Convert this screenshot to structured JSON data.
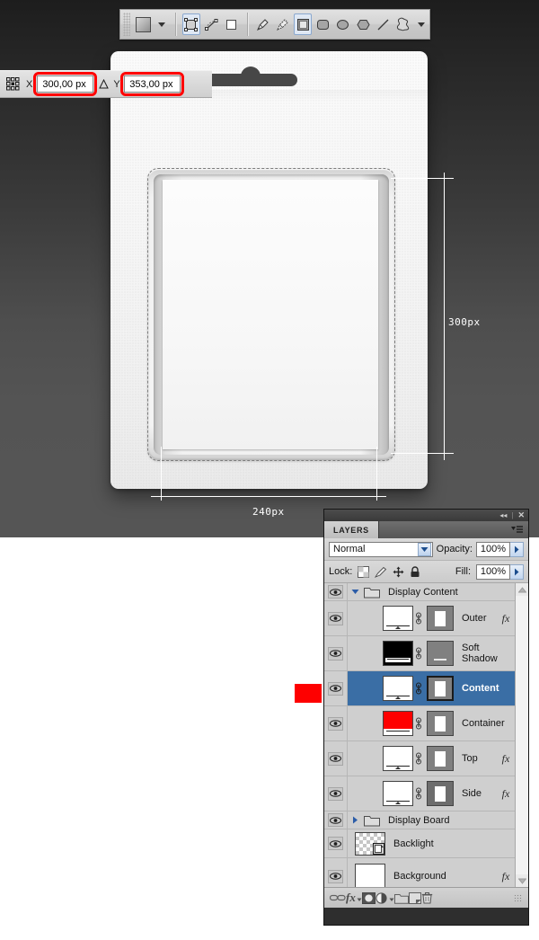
{
  "toolbar": {
    "shape_swatch_icon": "filled-square-swatch",
    "swatch_dropdown_icon": "chevron-down-icon",
    "mode_buttons": [
      {
        "name": "shape-layers-mode",
        "icon": "shape-layer-icon",
        "selected": true
      },
      {
        "name": "paths-mode",
        "icon": "path-icon",
        "selected": false
      },
      {
        "name": "fill-pixels-mode",
        "icon": "fill-pixels-icon",
        "selected": false
      }
    ],
    "tool_buttons": [
      {
        "name": "pen-tool",
        "icon": "pen-icon",
        "selected": false
      },
      {
        "name": "freeform-pen-tool",
        "icon": "freeform-pen-icon",
        "selected": false
      },
      {
        "name": "rectangle-tool",
        "icon": "rectangle-icon",
        "selected": true
      },
      {
        "name": "rounded-rectangle-tool",
        "icon": "rounded-rectangle-icon",
        "selected": false
      },
      {
        "name": "ellipse-tool",
        "icon": "ellipse-icon",
        "selected": false
      },
      {
        "name": "polygon-tool",
        "icon": "polygon-icon",
        "selected": false
      },
      {
        "name": "line-tool",
        "icon": "line-icon",
        "selected": false
      },
      {
        "name": "custom-shape-tool",
        "icon": "custom-shape-icon",
        "selected": false
      }
    ],
    "shapes_dropdown_icon": "chevron-down-icon"
  },
  "coord_bar": {
    "grid_icon": "reference-point-grid-icon",
    "x_label": "X:",
    "x_value": "300,00 px",
    "delta_icon": "delta-triangle-icon",
    "y_label": "Y:",
    "y_value": "353,00 px",
    "highlight_color": "#ff0000"
  },
  "measurements": {
    "height_label": "300px",
    "width_label": "240px",
    "guide_color": "#ffffff"
  },
  "swatch": {
    "name": "red-color-swatch",
    "color": "#fe0000"
  },
  "layers_panel": {
    "collapse_icon": "collapse-to-icons-icon",
    "close_icon": "close-icon",
    "tab_label": "LAYERS",
    "menu_icon": "panel-menu-icon",
    "blend_mode": "Normal",
    "blend_dropdown_icon": "chevron-down-icon",
    "opacity_label": "Opacity:",
    "opacity_value": "100%",
    "opacity_arrow_icon": "chevron-right-icon",
    "lock_label": "Lock:",
    "lock_icons": [
      {
        "name": "lock-transparent-pixels-icon",
        "glyph": "checker"
      },
      {
        "name": "lock-image-pixels-icon",
        "glyph": "brush"
      },
      {
        "name": "lock-position-icon",
        "glyph": "move"
      },
      {
        "name": "lock-all-icon",
        "glyph": "padlock"
      }
    ],
    "fill_label": "Fill:",
    "fill_value": "100%",
    "fill_arrow_icon": "chevron-right-icon",
    "selection_color": "#3a6ea5",
    "scroll_up_icon": "scroll-up-arrow-icon",
    "scroll_down_icon": "scroll-down-arrow-icon",
    "layers": [
      {
        "name": "Display Content",
        "kind": "group",
        "expanded": true,
        "visible": true,
        "disclosure_icon": "triangle-down-icon",
        "folder_icon": "folder-icon"
      },
      {
        "name": "Outer",
        "kind": "layer",
        "visible": true,
        "thumb": "doc-white",
        "mask": "white-rect",
        "link_icon": "link-chain-icon",
        "fx": true,
        "fx_label": "fx",
        "fx_arrow_icon": "triangle-down-icon",
        "selected": false
      },
      {
        "name": "Soft Shadow",
        "kind": "layer",
        "visible": true,
        "thumb": "doc-black",
        "mask": "line",
        "link_icon": "link-chain-icon",
        "fx": false,
        "selected": false
      },
      {
        "name": "Content",
        "kind": "layer",
        "visible": true,
        "thumb": "doc-white",
        "mask": "white-rect",
        "link_icon": "link-chain-icon",
        "fx": false,
        "selected": true
      },
      {
        "name": "Container",
        "kind": "layer",
        "visible": true,
        "thumb": "doc-red",
        "mask": "white-rect",
        "link_icon": "link-chain-icon",
        "fx": false,
        "selected": false
      },
      {
        "name": "Top",
        "kind": "layer",
        "visible": true,
        "thumb": "doc-white",
        "mask": "white-rect",
        "link_icon": "link-chain-icon",
        "fx": true,
        "fx_label": "fx",
        "fx_arrow_icon": "triangle-down-icon",
        "selected": false
      },
      {
        "name": "Side",
        "kind": "layer",
        "visible": true,
        "thumb": "doc-white",
        "mask": "white-rect",
        "link_icon": "link-chain-icon",
        "fx": true,
        "fx_label": "fx",
        "fx_arrow_icon": "triangle-down-icon",
        "selected": false
      },
      {
        "name": "Display Board",
        "kind": "group",
        "expanded": false,
        "visible": true,
        "disclosure_icon": "triangle-right-icon",
        "folder_icon": "folder-icon"
      },
      {
        "name": "Backlight",
        "kind": "layer",
        "visible": true,
        "thumb": "checker",
        "badge_icon": "smart-object-icon",
        "fx": false,
        "selected": false
      },
      {
        "name": "Background",
        "kind": "layer",
        "visible": true,
        "thumb": "white",
        "fx": true,
        "fx_label": "fx",
        "fx_arrow_icon": "triangle-down-icon",
        "selected": false
      }
    ],
    "footer_buttons": [
      {
        "name": "link-layers-button",
        "icon": "link-chain-icon"
      },
      {
        "name": "add-layer-style-button",
        "icon": "fx-icon",
        "label": "fx"
      },
      {
        "name": "add-layer-mask-button",
        "icon": "layer-mask-icon"
      },
      {
        "name": "new-adjustment-layer-button",
        "icon": "half-circle-icon"
      },
      {
        "name": "new-group-button",
        "icon": "folder-icon"
      },
      {
        "name": "new-layer-button",
        "icon": "new-layer-icon"
      },
      {
        "name": "delete-layer-button",
        "icon": "trash-icon"
      }
    ],
    "resize_grip_icon": "resize-grip-icon"
  },
  "canvas": {
    "device_label": "display-device-mockup",
    "eye_icon": "eye-visibility-icon"
  }
}
